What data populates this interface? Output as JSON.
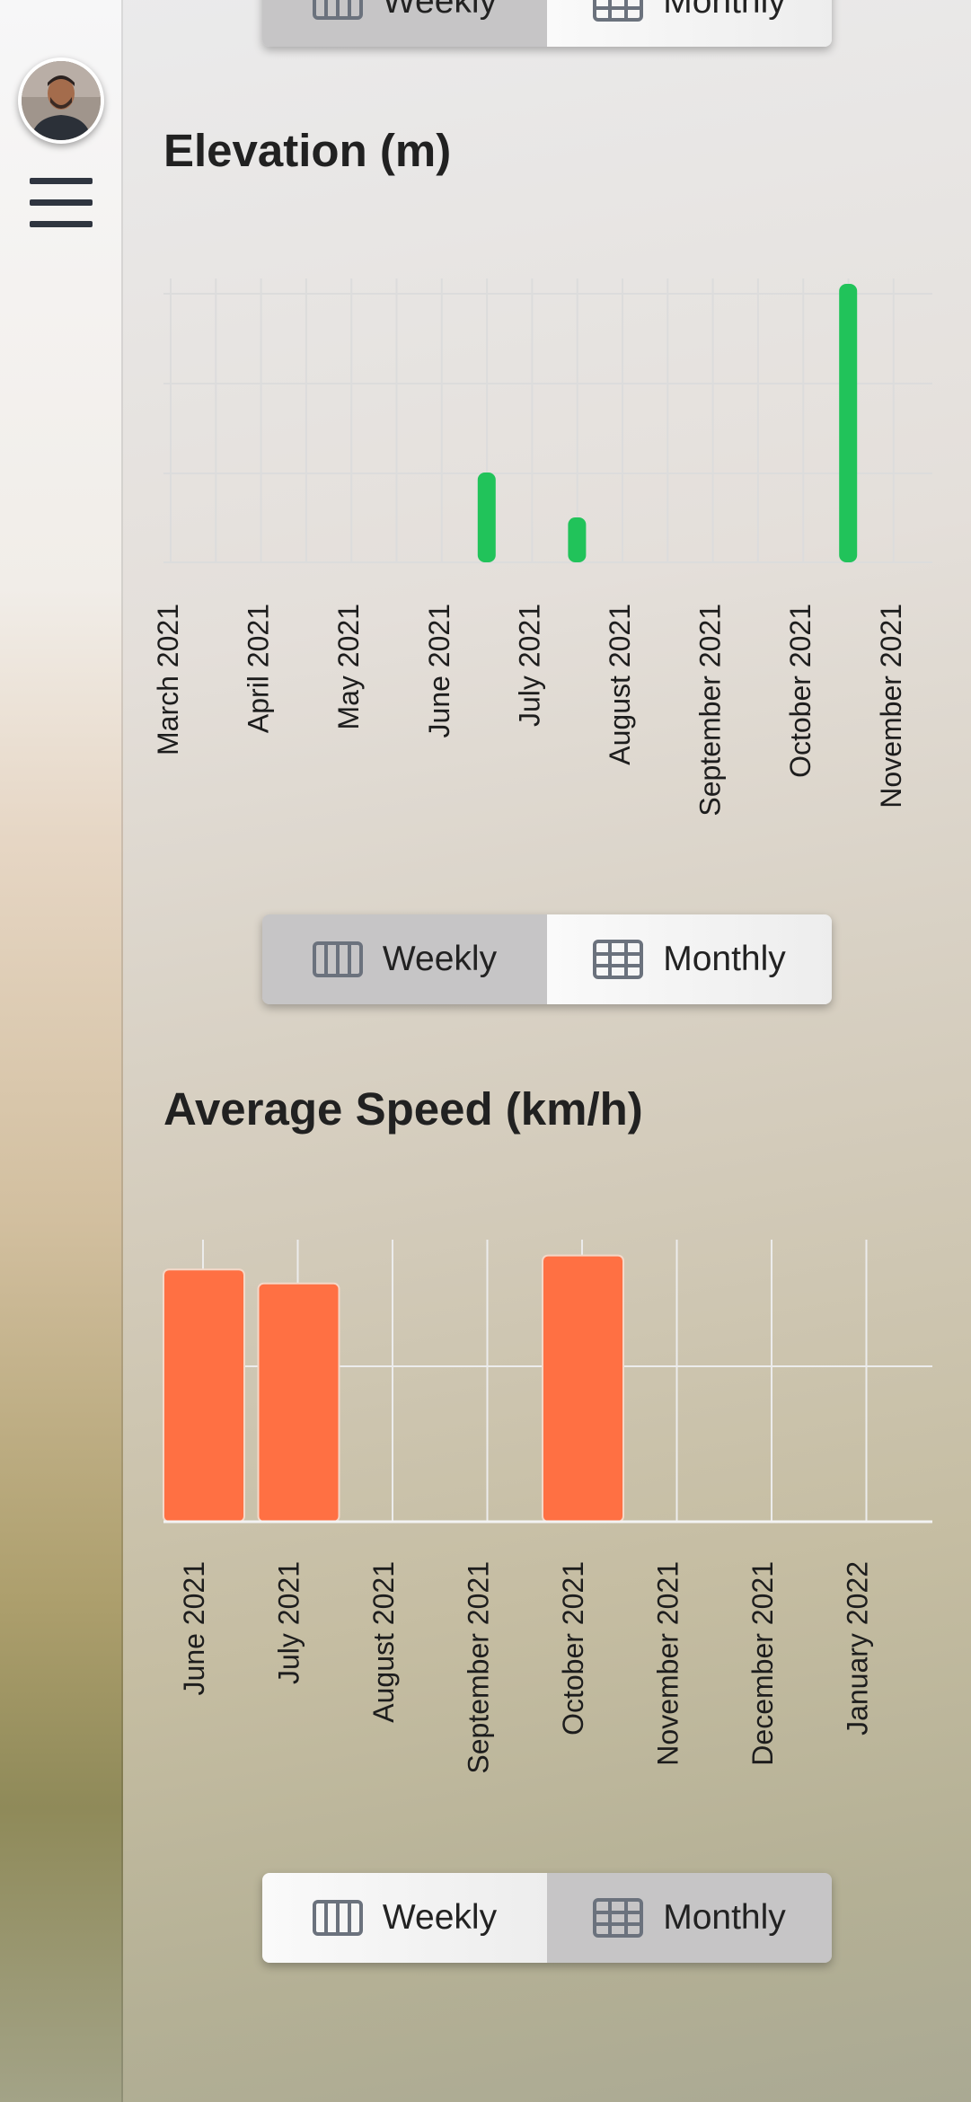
{
  "toggles": [
    {
      "weekly_label": "Weekly",
      "monthly_label": "Monthly",
      "selected": "weekly"
    },
    {
      "weekly_label": "Weekly",
      "monthly_label": "Monthly",
      "selected": "weekly"
    },
    {
      "weekly_label": "Weekly",
      "monthly_label": "Monthly",
      "selected": "monthly"
    }
  ],
  "icons": {
    "menu": "hamburger-menu-icon",
    "avatar": "user-avatar",
    "weekly": "weekly-columns-icon",
    "monthly": "monthly-grid-icon"
  },
  "colors": {
    "elevation_bar": "#21c35a",
    "speed_bar": "#ff7043",
    "icon": "#6b727d"
  },
  "chart_data": [
    {
      "type": "bar",
      "title": "Elevation (m)",
      "categories": [
        "March 2021",
        "April 2021",
        "May 2021",
        "June 2021",
        "July 2021",
        "August 2021",
        "September 2021",
        "October 2021",
        "November 2021"
      ],
      "values": [
        0,
        0,
        0,
        100,
        50,
        0,
        0,
        310,
        0
      ],
      "ylim": [
        0,
        300
      ],
      "grid": true,
      "color": "#21c35a"
    },
    {
      "type": "bar",
      "title": "Average Speed (km/h)",
      "categories": [
        "June 2021",
        "July 2021",
        "August 2021",
        "September 2021",
        "October 2021",
        "November 2021",
        "December 2021",
        "January 2022"
      ],
      "values": [
        18,
        17,
        0,
        0,
        19,
        0,
        0,
        0
      ],
      "ylim": [
        0,
        20
      ],
      "grid": true,
      "color": "#ff7043"
    }
  ]
}
